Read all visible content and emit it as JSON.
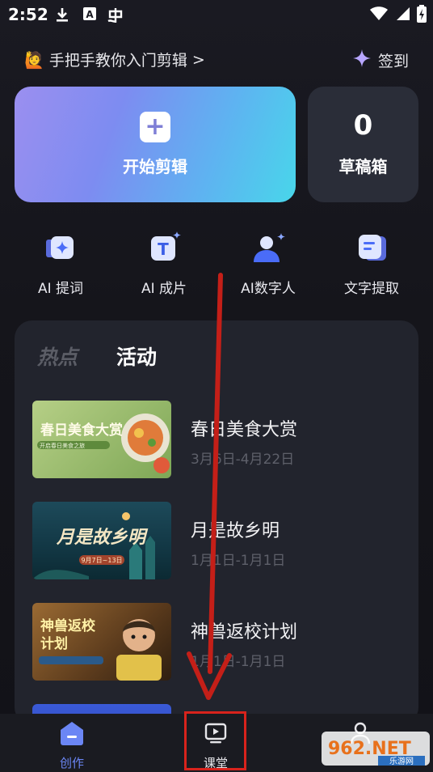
{
  "status_bar": {
    "time": "2:52",
    "icons": [
      "download-icon",
      "a-box-icon",
      "notification-icon"
    ],
    "right_icons": [
      "wifi-icon",
      "signal-icon",
      "battery-charging-icon"
    ]
  },
  "header": {
    "tutorial_text": "手把手教你入门剪辑",
    "tutorial_arrow": ">",
    "checkin_label": "签到"
  },
  "start_card": {
    "plus": "+",
    "label": "开始剪辑"
  },
  "draft_card": {
    "count": "0",
    "label": "草稿箱"
  },
  "tools": [
    {
      "label": "AI 提词",
      "icon": "ai-prompt-icon"
    },
    {
      "label": "AI 成片",
      "icon": "ai-film-icon"
    },
    {
      "label": "AI数字人",
      "icon": "ai-avatar-icon"
    },
    {
      "label": "文字提取",
      "icon": "text-extract-icon"
    }
  ],
  "panel": {
    "tabs": [
      {
        "label": "热点",
        "active": false
      },
      {
        "label": "活动",
        "active": true
      }
    ],
    "activities": [
      {
        "title": "春日美食大赏",
        "date": "3月6日-4月22日",
        "thumb_text": "春日美食大赏",
        "thumb_sub": "开启春日美食之旅",
        "thumb_colors": [
          "#a5c27a",
          "#6e9a49"
        ]
      },
      {
        "title": "月是故乡明",
        "date": "1月1日-1月1日",
        "thumb_text": "月是故乡明",
        "thumb_sub": "9月7日~13日",
        "thumb_colors": [
          "#1d4a5a",
          "#0f2c38"
        ]
      },
      {
        "title": "神兽返校计划",
        "date": "1月1日-1月1日",
        "thumb_text": "神兽返校计划",
        "thumb_sub": "",
        "thumb_colors": [
          "#8a5a2a",
          "#3a2414"
        ]
      }
    ]
  },
  "bottom_nav": [
    {
      "label": "创作",
      "icon": "create-icon",
      "active": true
    },
    {
      "label": "课堂",
      "icon": "classroom-icon",
      "active": false
    },
    {
      "label": "",
      "icon": "profile-icon",
      "active": false
    }
  ],
  "watermark": {
    "text": "962.NET",
    "sub": "乐游网"
  },
  "colors": {
    "accent": "#5b8ef0",
    "panel_bg": "#22242d",
    "annotation_red": "#d8231c"
  }
}
